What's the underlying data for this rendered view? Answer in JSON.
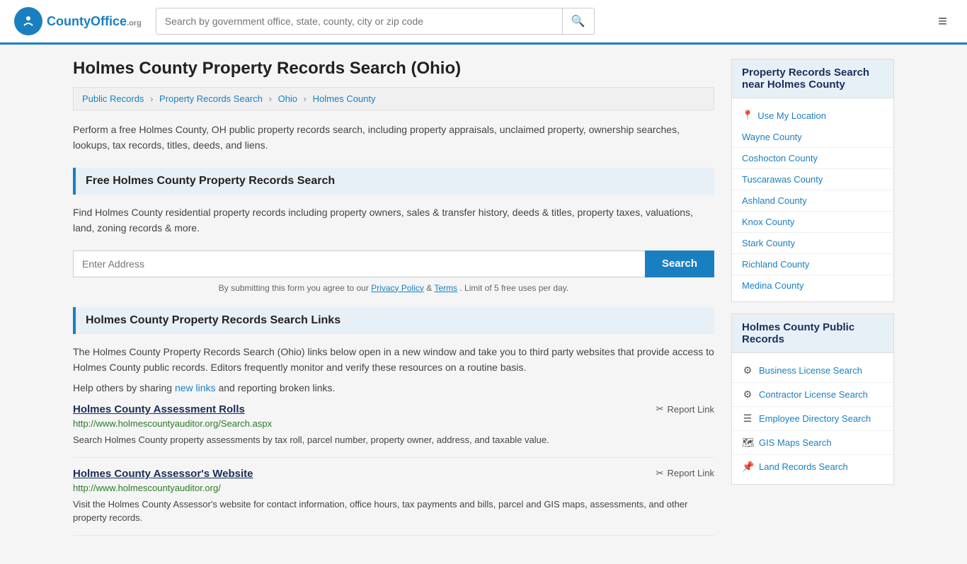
{
  "header": {
    "logo_text": "CountyOffice",
    "logo_org": ".org",
    "search_placeholder": "Search by government office, state, county, city or zip code",
    "search_icon": "🔍",
    "menu_icon": "≡"
  },
  "page": {
    "title": "Holmes County Property Records Search (Ohio)",
    "breadcrumbs": [
      {
        "label": "Public Records",
        "href": "#"
      },
      {
        "label": "Property Records Search",
        "href": "#"
      },
      {
        "label": "Ohio",
        "href": "#"
      },
      {
        "label": "Holmes County",
        "href": "#"
      }
    ],
    "intro": "Perform a free Holmes County, OH public property records search, including property appraisals, unclaimed property, ownership searches, lookups, tax records, titles, deeds, and liens."
  },
  "free_search": {
    "header": "Free Holmes County Property Records Search",
    "description": "Find Holmes County residential property records including property owners, sales & transfer history, deeds & titles, property taxes, valuations, land, zoning records & more.",
    "input_placeholder": "Enter Address",
    "search_button": "Search",
    "disclaimer": "By submitting this form you agree to our",
    "privacy_label": "Privacy Policy",
    "terms_label": "Terms",
    "disclaimer_end": ". Limit of 5 free uses per day."
  },
  "links_section": {
    "header": "Holmes County Property Records Search Links",
    "intro": "The Holmes County Property Records Search (Ohio) links below open in a new window and take you to third party websites that provide access to Holmes County public records. Editors frequently monitor and verify these resources on a routine basis.",
    "share_text": "Help others by sharing",
    "new_links_label": "new links",
    "share_end": "and reporting broken links.",
    "items": [
      {
        "title": "Holmes County Assessment Rolls",
        "url": "http://www.holmescountyauditor.org/Search.aspx",
        "description": "Search Holmes County property assessments by tax roll, parcel number, property owner, address, and taxable value.",
        "report_label": "Report Link"
      },
      {
        "title": "Holmes County Assessor's Website",
        "url": "http://www.holmescountyauditor.org/",
        "description": "Visit the Holmes County Assessor's website for contact information, office hours, tax payments and bills, parcel and GIS maps, assessments, and other property records.",
        "report_label": "Report Link"
      }
    ]
  },
  "sidebar": {
    "nearby_header": "Property Records Search near Holmes County",
    "use_my_location": "Use My Location",
    "nearby_counties": [
      "Wayne County",
      "Coshocton County",
      "Tuscarawas County",
      "Ashland County",
      "Knox County",
      "Stark County",
      "Richland County",
      "Medina County"
    ],
    "public_records_header": "Holmes County Public Records",
    "public_records_links": [
      {
        "icon": "⚙",
        "label": "Business License Search"
      },
      {
        "icon": "⚙",
        "label": "Contractor License Search"
      },
      {
        "icon": "☰",
        "label": "Employee Directory Search"
      },
      {
        "icon": "🗺",
        "label": "GIS Maps Search"
      },
      {
        "icon": "📌",
        "label": "Land Records Search"
      }
    ]
  }
}
